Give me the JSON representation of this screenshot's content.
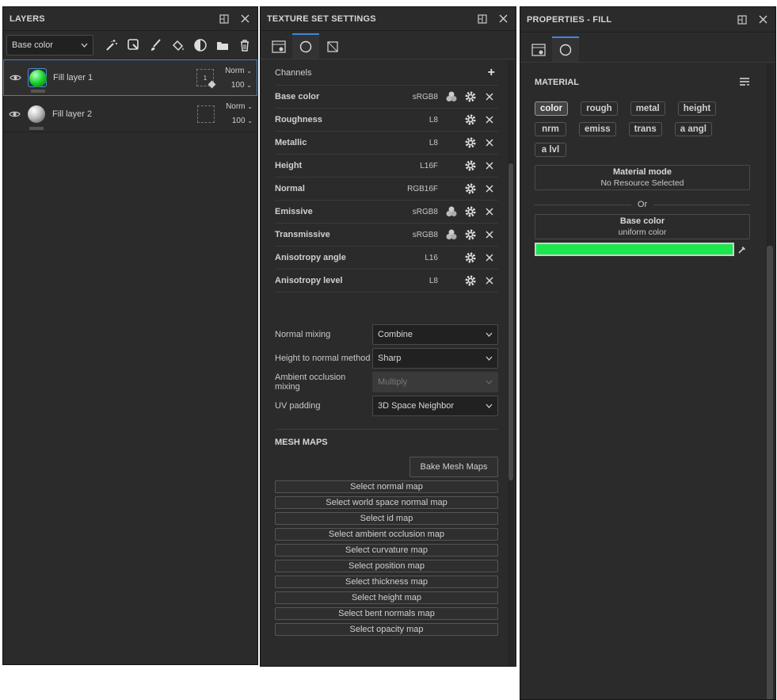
{
  "layers": {
    "title": "LAYERS",
    "channel_select": "Base color",
    "items": [
      {
        "name": "Fill layer 1",
        "blend": "Norm",
        "opacity": "100",
        "mask_count": "1",
        "thumb_color": "#1ed830"
      },
      {
        "name": "Fill layer 2",
        "blend": "Norm",
        "opacity": "100",
        "mask_count": "",
        "thumb_color": "#bdbdbd"
      }
    ]
  },
  "texset": {
    "title": "TEXTURE SET SETTINGS",
    "channels_label": "Channels",
    "channels": [
      {
        "name": "Base color",
        "format": "sRGB8",
        "color_icon": true
      },
      {
        "name": "Roughness",
        "format": "L8",
        "color_icon": false
      },
      {
        "name": "Metallic",
        "format": "L8",
        "color_icon": false
      },
      {
        "name": "Height",
        "format": "L16F",
        "color_icon": false
      },
      {
        "name": "Normal",
        "format": "RGB16F",
        "color_icon": false
      },
      {
        "name": "Emissive",
        "format": "sRGB8",
        "color_icon": true
      },
      {
        "name": "Transmissive",
        "format": "sRGB8",
        "color_icon": true
      },
      {
        "name": "Anisotropy angle",
        "format": "L16",
        "color_icon": false
      },
      {
        "name": "Anisotropy level",
        "format": "L8",
        "color_icon": false
      }
    ],
    "settings": [
      {
        "label": "Normal mixing",
        "value": "Combine",
        "disabled": false
      },
      {
        "label": "Height to normal method",
        "value": "Sharp",
        "disabled": false
      },
      {
        "label": "Ambient occlusion mixing",
        "value": "Multiply",
        "disabled": true
      },
      {
        "label": "UV padding",
        "value": "3D Space Neighbor",
        "disabled": false
      }
    ],
    "mesh_maps_title": "MESH MAPS",
    "bake_label": "Bake Mesh Maps",
    "mesh_maps": [
      "Select normal map",
      "Select world space normal map",
      "Select id map",
      "Select ambient occlusion map",
      "Select curvature map",
      "Select position map",
      "Select thickness map",
      "Select height map",
      "Select bent normals map",
      "Select opacity map"
    ]
  },
  "props": {
    "title": "PROPERTIES - FILL",
    "material_label": "MATERIAL",
    "chips": [
      {
        "label": "color",
        "active": true
      },
      {
        "label": "rough",
        "active": false
      },
      {
        "label": "metal",
        "active": false
      },
      {
        "label": "height",
        "active": false
      },
      {
        "label": "nrm",
        "active": false
      },
      {
        "label": "emiss",
        "active": false
      },
      {
        "label": "trans",
        "active": false
      },
      {
        "label": "a angl",
        "active": false
      },
      {
        "label": "a lvl",
        "active": false
      }
    ],
    "material_mode": {
      "title": "Material mode",
      "subtitle": "No Resource Selected"
    },
    "or_label": "Or",
    "base_color": {
      "title": "Base color",
      "subtitle": "uniform color",
      "color": "#1be84f"
    }
  }
}
